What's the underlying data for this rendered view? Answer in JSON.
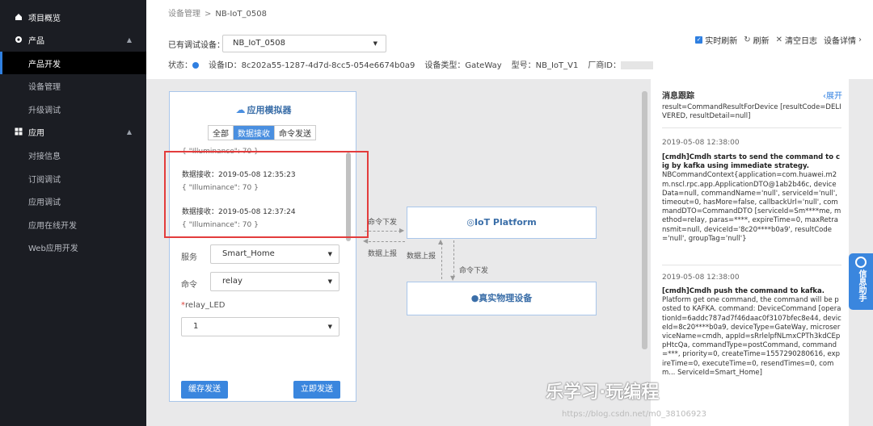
{
  "sidebar": {
    "items": [
      {
        "label": "项目概览",
        "type": "top",
        "icon": "home-icon"
      },
      {
        "label": "产品",
        "type": "top",
        "icon": "gear-icon",
        "arrow": "▲"
      },
      {
        "label": "产品开发",
        "type": "sub",
        "active": true
      },
      {
        "label": "设备管理",
        "type": "sub"
      },
      {
        "label": "升级调试",
        "type": "sub"
      },
      {
        "label": "应用",
        "type": "top",
        "icon": "grid-icon",
        "arrow": "▲"
      },
      {
        "label": "对接信息",
        "type": "sub"
      },
      {
        "label": "订阅调试",
        "type": "sub"
      },
      {
        "label": "应用调试",
        "type": "sub"
      },
      {
        "label": "应用在线开发",
        "type": "sub"
      },
      {
        "label": "Web应用开发",
        "type": "sub"
      }
    ]
  },
  "breadcrumb": {
    "parent": "设备管理",
    "separator": ">",
    "current": "NB-IoT_0508"
  },
  "device": {
    "label": "已有调试设备：",
    "selected": "NB_IoT_0508"
  },
  "toolbar": {
    "realtime_refresh": "实时刷新",
    "refresh": "刷新",
    "clear_log": "清空日志",
    "device_detail": "设备详情"
  },
  "status": {
    "status_label": "状态：",
    "device_id_label": "设备ID：",
    "device_id": "8c202a55-1287-4d7d-8cc5-054e6674b0a9",
    "device_type_label": "设备类型：",
    "device_type": "GateWay",
    "model_label": "型号：",
    "model": "NB_IoT_V1",
    "vendor_label": "厂商ID："
  },
  "simulator": {
    "title": "应用模拟器",
    "tabs": [
      "全部",
      "数据接收",
      "命令发送"
    ],
    "active_tab": 1,
    "messages": [
      {
        "title": "数据接收：2019-05-08 12:35:23",
        "value": "{ \"Illuminance\": 70 }"
      },
      {
        "title": "数据接收：2019-05-08 12:37:24",
        "value": "{ \"Illuminance\": 70 }"
      }
    ],
    "prev_value": "{ \"Illuminance\": 70 }",
    "service_label": "服务",
    "service_value": "Smart_Home",
    "command_label": "命令",
    "command_value": "relay",
    "param_required": "*",
    "param_label": "relay_LED",
    "param_value": "1",
    "cache_send": "缓存发送",
    "send_now": "立即发送"
  },
  "flow": {
    "platform": "IoT Platform",
    "device": "真实物理设备",
    "cmd_down_1": "命令下发",
    "data_up_1": "数据上报",
    "data_up_2": "数据上报",
    "cmd_down_2": "命令下发"
  },
  "trace": {
    "title": "消息跟踪",
    "expand": "‹展开",
    "block0": "result=CommandResultForDevice [resultCode=DELIVERED, resultDetail=null]",
    "ts1": "2019-05-08 12:38:00",
    "block1_head": "[cmdh]Cmdh starts to send the command to cig by kafka using immediate strategy.",
    "block1_body": "NBCommandContext{application=com.huawei.m2m.nscl.rpc.app.ApplicationDTO@1ab2b46c, deviceData=null, commandName='null', serviceId='null', timeout=0, hasMore=false, callbackUrl='null', commandDTO=CommandDTO [serviceId=Sm****me, method=relay, paras=****, expireTime=0, maxRetransmit=null, deviceId='8c20****b0a9', resultCode='null', groupTag='null'}",
    "ts2": "2019-05-08 12:38:00",
    "block2_head": "[cmdh]Cmdh push the command to kafka.",
    "block2_body": "Platform get one command, the command will be posted to KAFKA. command: DeviceCommand [operationId=6addc787ad7f46daac0f3107bfec8e44, deviceId=8c20****b0a9, deviceType=GateWay, microserviceName=cmdh, appId=sRrlelpfNLmxCPTh3kdCEppHtcQa, commandType=postCommand, command=***, priority=0, createTime=1557290280616, expireTime=0, executeTime=0, resendTimes=0, comm... ServiceId=Smart_Home]"
  },
  "helper": {
    "label": "信息助手"
  },
  "watermark": {
    "main": "乐学习·玩编程",
    "sub": "https://blog.csdn.net/m0_38106923"
  }
}
